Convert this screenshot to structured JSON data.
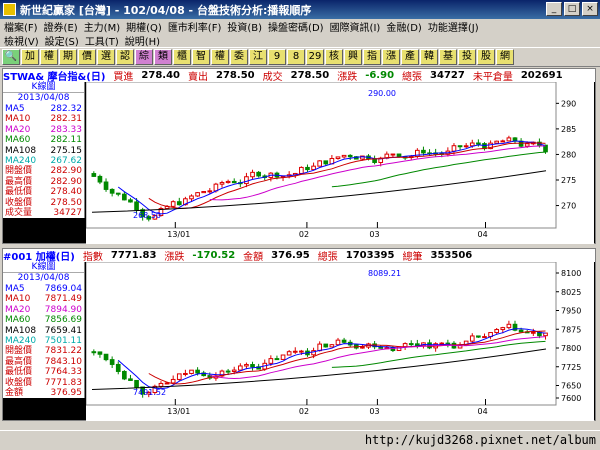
{
  "window": {
    "title": "新世紀贏家 [台灣] - 102/04/08 - 台盤技術分析:播報順序"
  },
  "menu": {
    "row1": [
      "檔案(F)",
      "證券(E)",
      "主力(M)",
      "期權(Q)",
      "匯市利率(F)",
      "投資(B)",
      "操盤密碼(D)",
      "國際資訊(I)",
      "金融(D)",
      "功能選擇(J)"
    ],
    "row2": [
      "檢視(V)",
      "設定(S)",
      "工具(T)",
      "說明(H)"
    ]
  },
  "toolbar": [
    "加",
    "權",
    "期",
    "價",
    "選",
    "認",
    "綜",
    "類",
    "櫃",
    "智",
    "權",
    "委",
    "江",
    "9",
    "8",
    "29",
    "核",
    "興",
    "指",
    "漲",
    "產",
    "韓",
    "基",
    "投",
    "股",
    "網"
  ],
  "panel1": {
    "symbol": "STWA& 摩台指&(日)",
    "bid_label": "買進",
    "bid": "278.40",
    "ask_label": "賣出",
    "ask": "278.50",
    "last_label": "成交",
    "last": "278.50",
    "chg_label": "漲跌",
    "chg": "-6.90",
    "vol_label": "總張",
    "vol": "34727",
    "oi_label": "未平倉量",
    "oi": "202691",
    "legend_title": "K線圖",
    "legend_date": "2013/04/08",
    "legend": [
      {
        "name": "MA5",
        "value": "282.32",
        "color": "#00f"
      },
      {
        "name": "MA10",
        "value": "282.31",
        "color": "#c00"
      },
      {
        "name": "MA20",
        "value": "283.33",
        "color": "#c0c"
      },
      {
        "name": "MA60",
        "value": "282.11",
        "color": "#080"
      },
      {
        "name": "MA108",
        "value": "275.15",
        "color": "#000"
      },
      {
        "name": "MA240",
        "value": "267.62",
        "color": "#0aa"
      },
      {
        "name": "開盤價",
        "value": "282.90",
        "color": "#c00"
      },
      {
        "name": "最高價",
        "value": "282.90",
        "color": "#c00"
      },
      {
        "name": "最低價",
        "value": "278.40",
        "color": "#c00"
      },
      {
        "name": "收盤價",
        "value": "278.50",
        "color": "#c00"
      },
      {
        "name": "成交量",
        "value": "34727",
        "color": "#c00"
      }
    ],
    "y_ticks": [
      "290",
      "285",
      "280",
      "275",
      "270"
    ],
    "x_ticks": [
      "13/01",
      "02",
      "03",
      "04"
    ],
    "high_label": "290.00",
    "low_label": "268.50"
  },
  "panel2": {
    "symbol": "#001 加權(日)",
    "idx_label": "指數",
    "idx": "7771.83",
    "chg_label": "漲跌",
    "chg": "-170.52",
    "amt_label": "金額",
    "amt": "376.95",
    "vol_label": "總張",
    "vol": "1703395",
    "count_label": "總筆",
    "count": "353506",
    "legend_title": "K線圖",
    "legend_date": "2013/04/08",
    "legend": [
      {
        "name": "MA5",
        "value": "7869.04",
        "color": "#00f"
      },
      {
        "name": "MA10",
        "value": "7871.49",
        "color": "#c00"
      },
      {
        "name": "MA20",
        "value": "7894.90",
        "color": "#c0c"
      },
      {
        "name": "MA60",
        "value": "7856.69",
        "color": "#080"
      },
      {
        "name": "MA108",
        "value": "7659.41",
        "color": "#000"
      },
      {
        "name": "MA240",
        "value": "7501.11",
        "color": "#0aa"
      },
      {
        "name": "開盤價",
        "value": "7831.22",
        "color": "#c00"
      },
      {
        "name": "最高價",
        "value": "7843.10",
        "color": "#c00"
      },
      {
        "name": "最低價",
        "value": "7764.33",
        "color": "#c00"
      },
      {
        "name": "收盤價",
        "value": "7771.83",
        "color": "#c00"
      },
      {
        "name": "金額",
        "value": "376.95",
        "color": "#c00"
      }
    ],
    "y_ticks": [
      "8100",
      "8025",
      "7950",
      "7875",
      "7800",
      "7725",
      "7650",
      "7600"
    ],
    "x_ticks": [
      "13/01",
      "02",
      "03",
      "04"
    ],
    "high_label": "8089.21",
    "low_label": "7491.52"
  },
  "footer": {
    "url": "http://kujd3268.pixnet.net/album"
  }
}
